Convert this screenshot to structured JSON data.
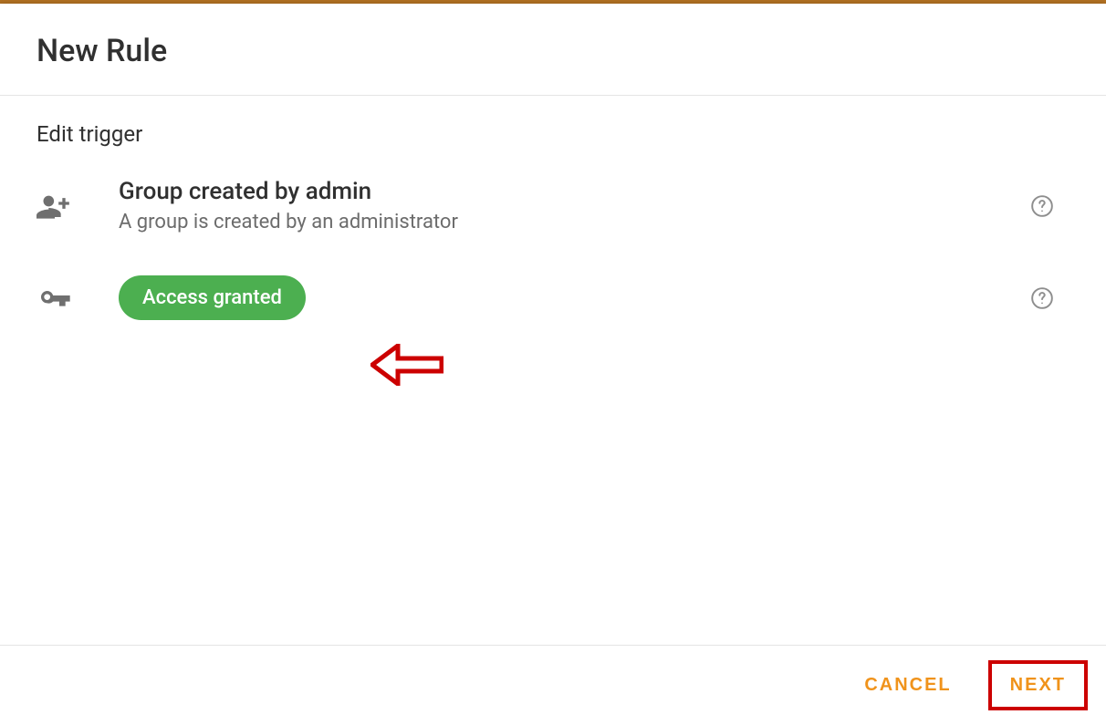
{
  "header": {
    "title": "New Rule"
  },
  "body": {
    "subtitle": "Edit trigger",
    "triggers": [
      {
        "icon": "group-add-icon",
        "title": "Group created by admin",
        "desc": "A group is created by an administrator"
      },
      {
        "icon": "key-icon",
        "chip": "Access granted"
      }
    ]
  },
  "footer": {
    "cancel": "CANCEL",
    "next": "NEXT"
  },
  "colors": {
    "chip_bg": "#4caf50",
    "accent": "#f0931b",
    "annotation": "#cc0000"
  }
}
